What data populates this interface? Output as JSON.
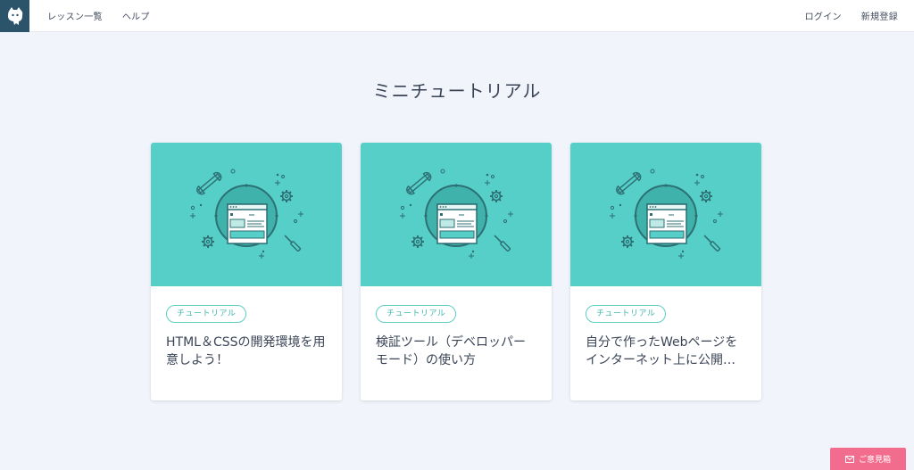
{
  "header": {
    "nav_left": [
      {
        "label": "レッスン一覧"
      },
      {
        "label": "ヘルプ"
      }
    ],
    "nav_right": [
      {
        "label": "ログイン"
      },
      {
        "label": "新規登録"
      }
    ]
  },
  "main": {
    "title": "ミニチュートリアル",
    "cards": [
      {
        "tag": "チュートリアル",
        "title": "HTML＆CSSの開発環境を用意しよう！"
      },
      {
        "tag": "チュートリアル",
        "title": "検証ツール（デベロッパーモード）の使い方"
      },
      {
        "tag": "チュートリアル",
        "title": "自分で作ったWebページをインターネット上に公開しよう"
      }
    ]
  },
  "feedback": {
    "label": "ご意見箱"
  },
  "colors": {
    "logo_bg": "#2b546a",
    "card_image_bg": "#55cfc7",
    "tag_border": "#5fcfc5",
    "feedback_bg": "#f26d8d",
    "page_bg": "#f1f4fb"
  },
  "icons": [
    "mascot-logo-icon",
    "wrench-icon",
    "gear-icon",
    "screwdriver-icon",
    "browser-window-icon",
    "mail-icon"
  ]
}
